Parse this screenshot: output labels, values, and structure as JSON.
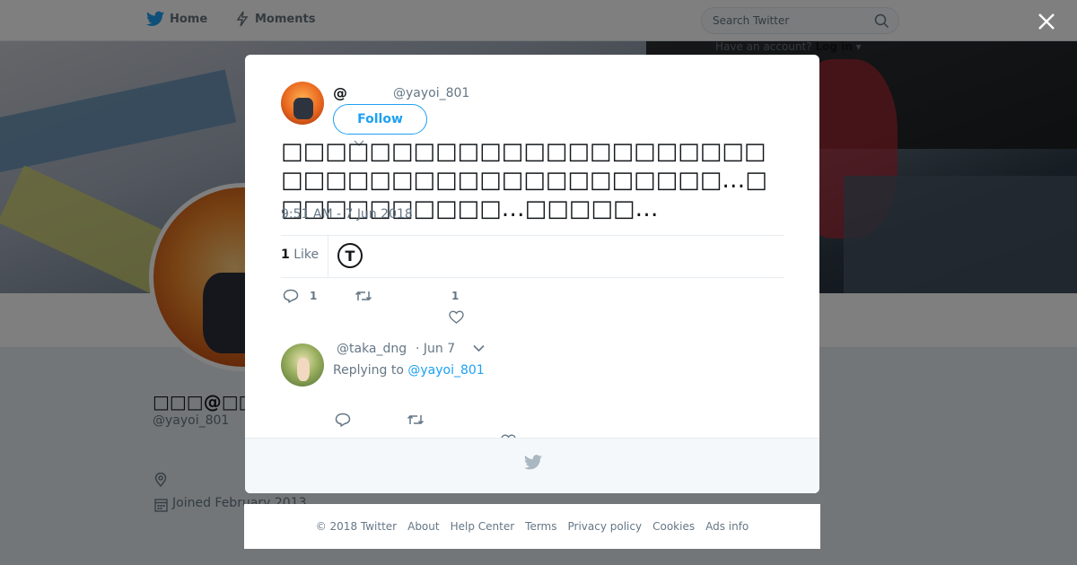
{
  "nav": {
    "home_label": "Home",
    "moments_label": "Moments"
  },
  "search": {
    "placeholder": "Search Twitter"
  },
  "login": {
    "prompt": "Have an account?",
    "label": "Log in"
  },
  "profile": {
    "display_name": "□□□@□□□□",
    "handle": "@yayoi_801",
    "joined": "Joined February 2013"
  },
  "tweet": {
    "author_name": "@",
    "author_handle": "@yayoi_801",
    "follow_label": "Follow",
    "text": "□□□□□□□□□□□□□□□□□□□□□□□□□□□□□□□□□□□□□□□□□□…□□□□□□□□□□□…□□□□□…",
    "timestamp": "9:51 AM - 7 Jun 2018",
    "likes_count": "1",
    "likes_word": "Like",
    "liker_initial": "T",
    "reply_count": "1",
    "like_count_label": "1"
  },
  "reply": {
    "handle": "@taka_dng",
    "date": "· Jun 7",
    "replying_prefix": "Replying to",
    "replying_handle": "@yayoi_801"
  },
  "footer": {
    "copyright": "© 2018 Twitter",
    "links": [
      "About",
      "Help Center",
      "Terms",
      "Privacy policy",
      "Cookies",
      "Ads info"
    ]
  },
  "colors": {
    "accent": "#1da1f2",
    "text": "#14171a",
    "muted": "#657786"
  }
}
